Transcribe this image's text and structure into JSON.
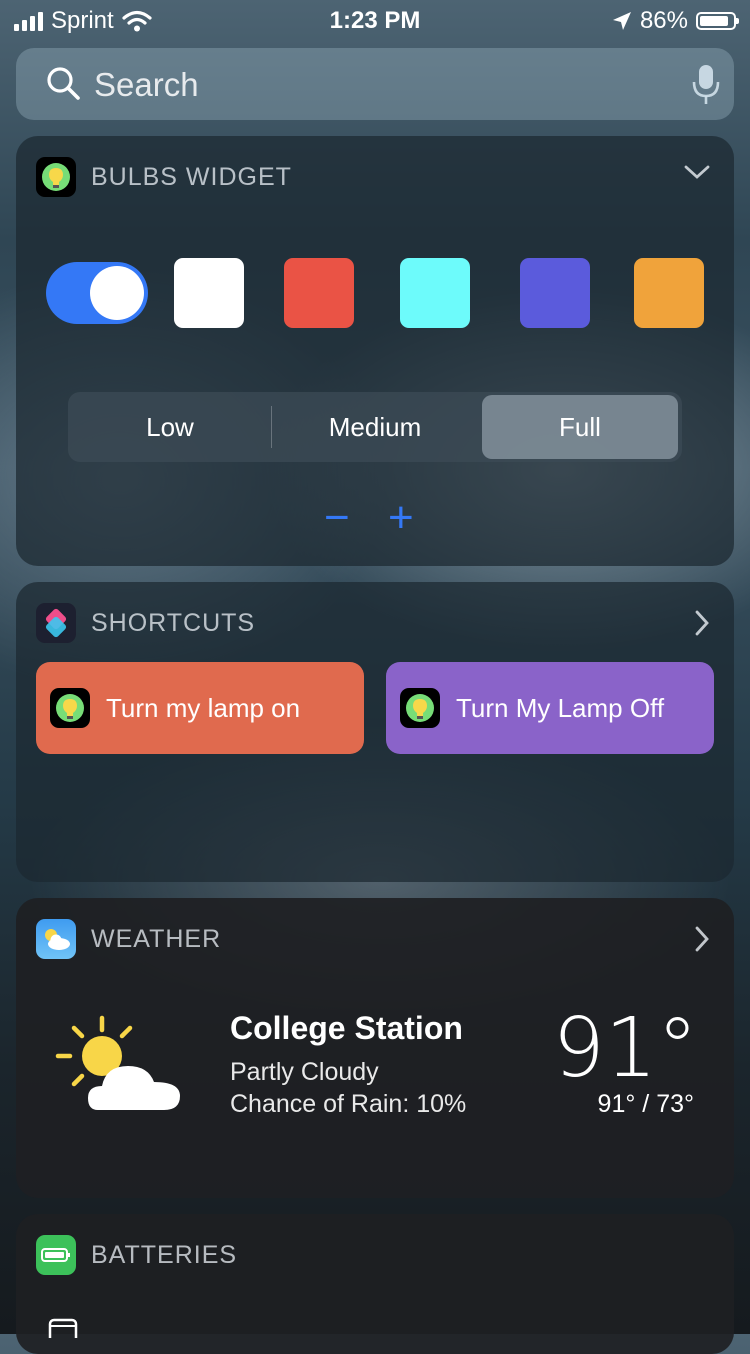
{
  "status_bar": {
    "carrier": "Sprint",
    "time": "1:23 PM",
    "battery": "86%",
    "battery_level": 0.86
  },
  "search": {
    "placeholder": "Search"
  },
  "bulbs_widget": {
    "title": "BULBS WIDGET",
    "toggle_on": true,
    "swatches": [
      "#ffffff",
      "#ea5345",
      "#6dfbfb",
      "#5b5bdc",
      "#f0a33b"
    ],
    "brightness": {
      "options": [
        "Low",
        "Medium",
        "Full"
      ],
      "selected": "Full"
    },
    "minus": "−",
    "plus": "+"
  },
  "shortcuts_widget": {
    "title": "SHORTCUTS",
    "items": [
      {
        "label": "Turn my lamp on",
        "color": "#e06a4e"
      },
      {
        "label": "Turn My Lamp Off",
        "color": "#8a63c9"
      }
    ]
  },
  "weather_widget": {
    "title": "WEATHER",
    "city": "College Station",
    "condition": "Partly Cloudy",
    "rain": "Chance of Rain: 10%",
    "temp": "91°",
    "range": "91° / 73°",
    "icon": "partly-cloudy-icon"
  },
  "batteries_widget": {
    "title": "BATTERIES"
  }
}
